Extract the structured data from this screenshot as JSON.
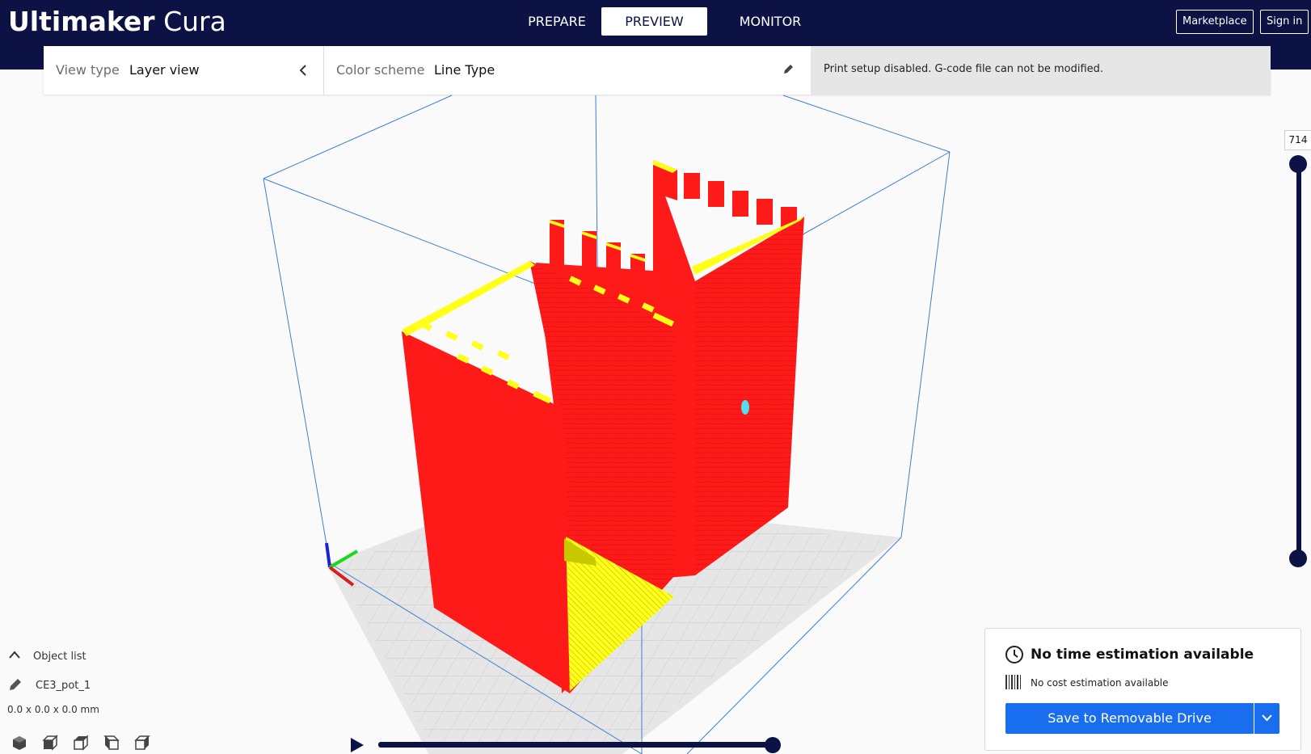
{
  "app": {
    "logo_bold": "Ultimaker",
    "logo_light": "Cura"
  },
  "stages": [
    {
      "label": "PREPARE",
      "active": false
    },
    {
      "label": "PREVIEW",
      "active": true
    },
    {
      "label": "MONITOR",
      "active": false
    }
  ],
  "header_buttons": {
    "marketplace": "Marketplace",
    "sign_in": "Sign in"
  },
  "toolbar": {
    "view_type_label": "View type",
    "view_type_value": "Layer view",
    "color_scheme_label": "Color scheme",
    "color_scheme_value": "Line Type",
    "notice": "Print setup disabled. G-code file can not be modified."
  },
  "layer_slider": {
    "current_layer": "714",
    "upper_level": 1.0,
    "lower_level": 0.0
  },
  "object_list": {
    "title": "Object list",
    "object_name": "CE3_pot_1",
    "dimensions": "0.0 x 0.0 x 0.0 mm"
  },
  "print_panel": {
    "time": "No time estimation available",
    "cost": "No cost estimation available",
    "save_button": "Save to Removable Drive"
  },
  "playback": {
    "progress": 1.0
  },
  "icons": [
    "chevron-left-icon",
    "pencil-icon",
    "chevron-up-icon",
    "clock-icon",
    "barcode-icon",
    "chevron-down-icon",
    "play-icon",
    "view-3d-icon",
    "view-front-icon",
    "view-top-icon",
    "view-left-icon",
    "view-right-icon"
  ],
  "colors": {
    "header": "#0c1243",
    "accent": "#196ef0",
    "wall": "#ff1a1a",
    "skin": "#ffff00",
    "build_volume": "#3a7fd1"
  }
}
